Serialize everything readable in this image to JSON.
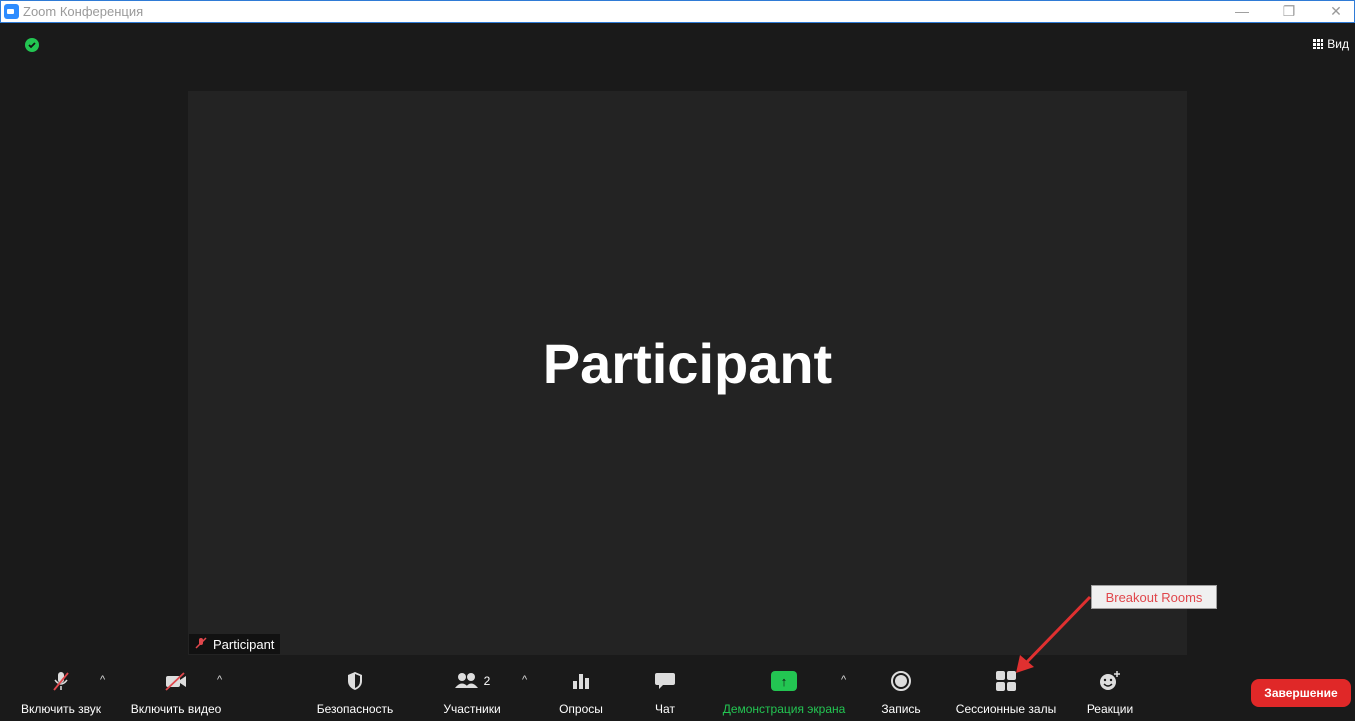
{
  "window": {
    "title": "Zoom Конференция",
    "minimize": "—",
    "maximize": "❐",
    "close": "✕"
  },
  "header": {
    "view_label": "Вид"
  },
  "stage": {
    "participant_name": "Participant"
  },
  "name_tag": {
    "label": "Participant"
  },
  "toolbar": {
    "unmute": "Включить звук",
    "start_video": "Включить видео",
    "security": "Безопасность",
    "participants": "Участники",
    "participants_count": "2",
    "polls": "Опросы",
    "chat": "Чат",
    "share_screen": "Демонстрация экрана",
    "record": "Запись",
    "breakout_rooms": "Сессионные залы",
    "reactions": "Реакции",
    "end": "Завершение"
  },
  "annotation": {
    "callout": "Breakout Rooms"
  },
  "colors": {
    "accent_green": "#23c552",
    "end_red": "#e02828",
    "annotation_red": "#e0474c",
    "zoom_blue": "#2d8cff"
  },
  "icons": [
    "zoom-logo-icon",
    "shield-check-icon",
    "grid-view-icon",
    "mic-off-icon",
    "video-off-icon",
    "shield-icon",
    "participants-icon",
    "polls-icon",
    "chat-icon",
    "share-screen-icon",
    "record-icon",
    "breakout-rooms-icon",
    "reactions-icon",
    "arrow-icon"
  ]
}
